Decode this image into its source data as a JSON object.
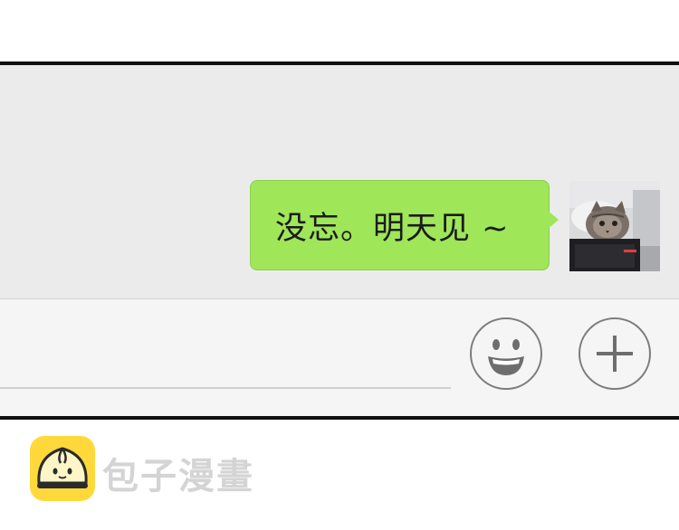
{
  "chat": {
    "message": "没忘。明天见 ~"
  },
  "icons": {
    "emoji": "smiley-face-icon",
    "plus": "plus-icon",
    "avatar": "cat-photo-avatar",
    "logo": "steamed-bun-logo-icon"
  },
  "colors": {
    "bubble": "#9fe659",
    "chat_background": "#ebebeb",
    "input_background": "#f5f5f6",
    "icon_stroke": "#7c7c7c",
    "logo_yellow": "#ffd93b",
    "watermark": "#d4d4d4"
  },
  "watermark": {
    "text": "包子漫畫"
  }
}
